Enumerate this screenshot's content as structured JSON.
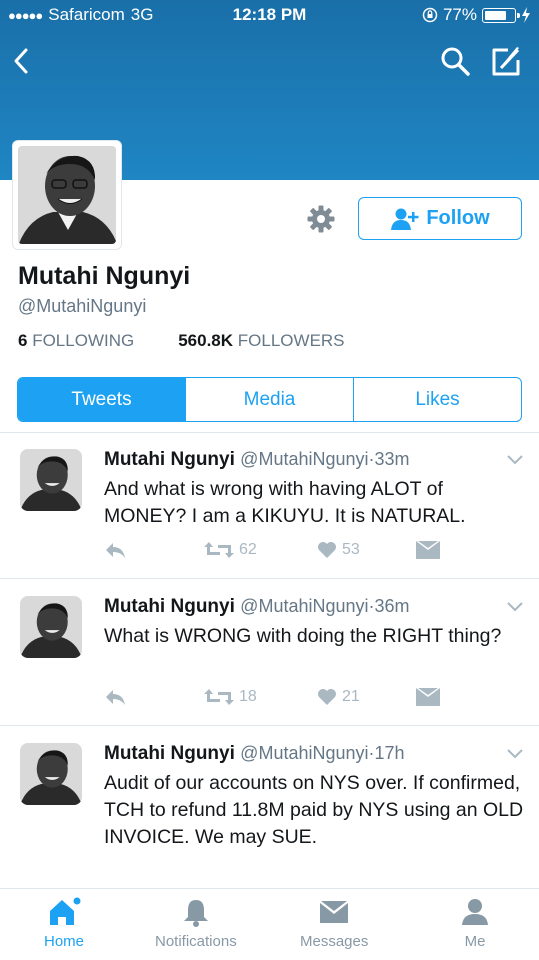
{
  "status_bar": {
    "signal": "●●●●●",
    "carrier": "Safaricom",
    "network": "3G",
    "time": "12:18 PM",
    "battery": "77%",
    "battery_level": 0.77
  },
  "nav": {
    "back_icon": "chevron-left-icon",
    "search_icon": "search-icon",
    "compose_icon": "compose-icon"
  },
  "profile": {
    "name": "Mutahi Ngunyi",
    "handle": "@MutahiNgunyi",
    "following_count": "6",
    "following_label": "FOLLOWING",
    "followers_count": "560.8K",
    "followers_label": "FOLLOWERS",
    "follow_label": "Follow"
  },
  "tabs": [
    {
      "label": "Tweets",
      "active": true
    },
    {
      "label": "Media",
      "active": false
    },
    {
      "label": "Likes",
      "active": false
    }
  ],
  "tweets": [
    {
      "name": "Mutahi Ngunyi",
      "handle": "@MutahiNgunyi",
      "sep": "·",
      "time": "33m",
      "text": "And what is wrong with having ALOT of MONEY? I am a KIKUYU. It is NATURAL.",
      "retweets": "62",
      "likes": "53"
    },
    {
      "name": "Mutahi Ngunyi",
      "handle": "@MutahiNgunyi",
      "sep": "·",
      "time": "36m",
      "text": "What is WRONG with doing the RIGHT thing?",
      "retweets": "18",
      "likes": "21"
    },
    {
      "name": "Mutahi Ngunyi",
      "handle": "@MutahiNgunyi",
      "sep": "·",
      "time": "17h",
      "text": "Audit of our accounts on NYS over. If confirmed, TCH to refund 11.8M paid by NYS using an OLD INVOICE. We may SUE."
    }
  ],
  "bottom_nav": [
    {
      "label": "Home",
      "icon": "home-icon",
      "active": true
    },
    {
      "label": "Notifications",
      "icon": "bell-icon",
      "active": false
    },
    {
      "label": "Messages",
      "icon": "envelope-icon",
      "active": false
    },
    {
      "label": "Me",
      "icon": "person-icon",
      "active": false
    }
  ],
  "colors": {
    "brand": "#1da1f2",
    "banner": "#1f86c4",
    "muted": "#657786",
    "icon_muted": "#aab8c2"
  }
}
